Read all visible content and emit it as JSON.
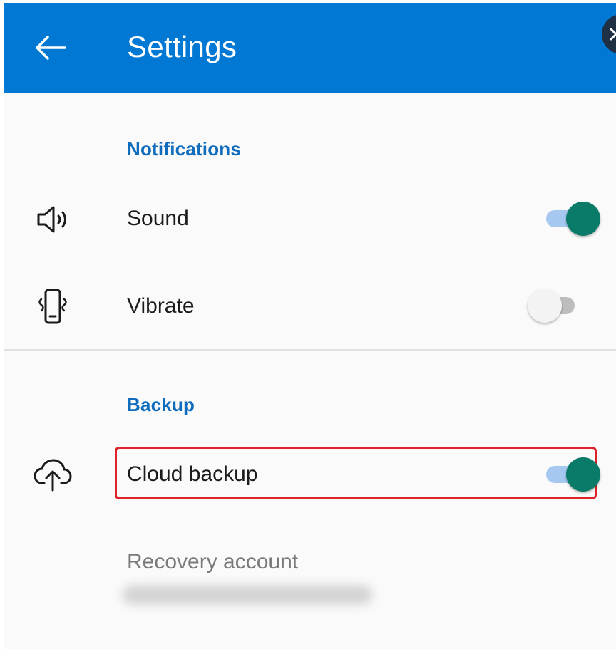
{
  "app_bar": {
    "title": "Settings",
    "back_icon": "arrow-left-icon",
    "background_color": "#0078d4"
  },
  "sections": {
    "notifications": {
      "header": "Notifications",
      "sound": {
        "label": "Sound",
        "icon": "speaker-icon",
        "enabled": true
      },
      "vibrate": {
        "label": "Vibrate",
        "icon": "vibrate-phone-icon",
        "enabled": false
      }
    },
    "backup": {
      "header": "Backup",
      "cloud_backup": {
        "label": "Cloud backup",
        "icon": "cloud-upload-icon",
        "enabled": true,
        "highlighted": true
      },
      "recovery_account": {
        "label": "Recovery account",
        "value_redacted": true
      }
    }
  },
  "colors": {
    "accent": "#0f6cbd",
    "toggle_on_thumb": "#0a7b68",
    "toggle_on_track": "#a6c8f0",
    "highlight": "#e0232b"
  }
}
